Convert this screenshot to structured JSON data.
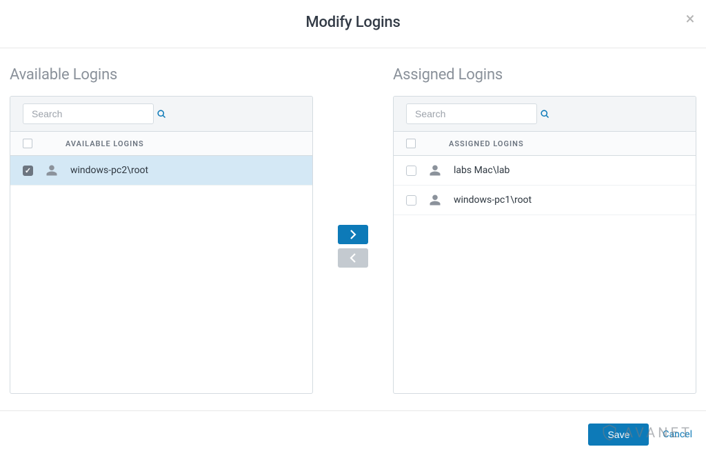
{
  "header": {
    "title": "Modify Logins"
  },
  "available": {
    "title": "Available Logins",
    "search_placeholder": "Search",
    "column_header": "AVAILABLE LOGINS",
    "items": [
      {
        "name": "windows-pc2\\root",
        "selected": true
      }
    ]
  },
  "assigned": {
    "title": "Assigned Logins",
    "search_placeholder": "Search",
    "column_header": "ASSIGNED LOGINS",
    "items": [
      {
        "name": "labs Mac\\lab",
        "selected": false
      },
      {
        "name": "windows-pc1\\root",
        "selected": false
      }
    ]
  },
  "footer": {
    "save": "Save",
    "cancel": "Cancel"
  },
  "watermark": "AVANET"
}
